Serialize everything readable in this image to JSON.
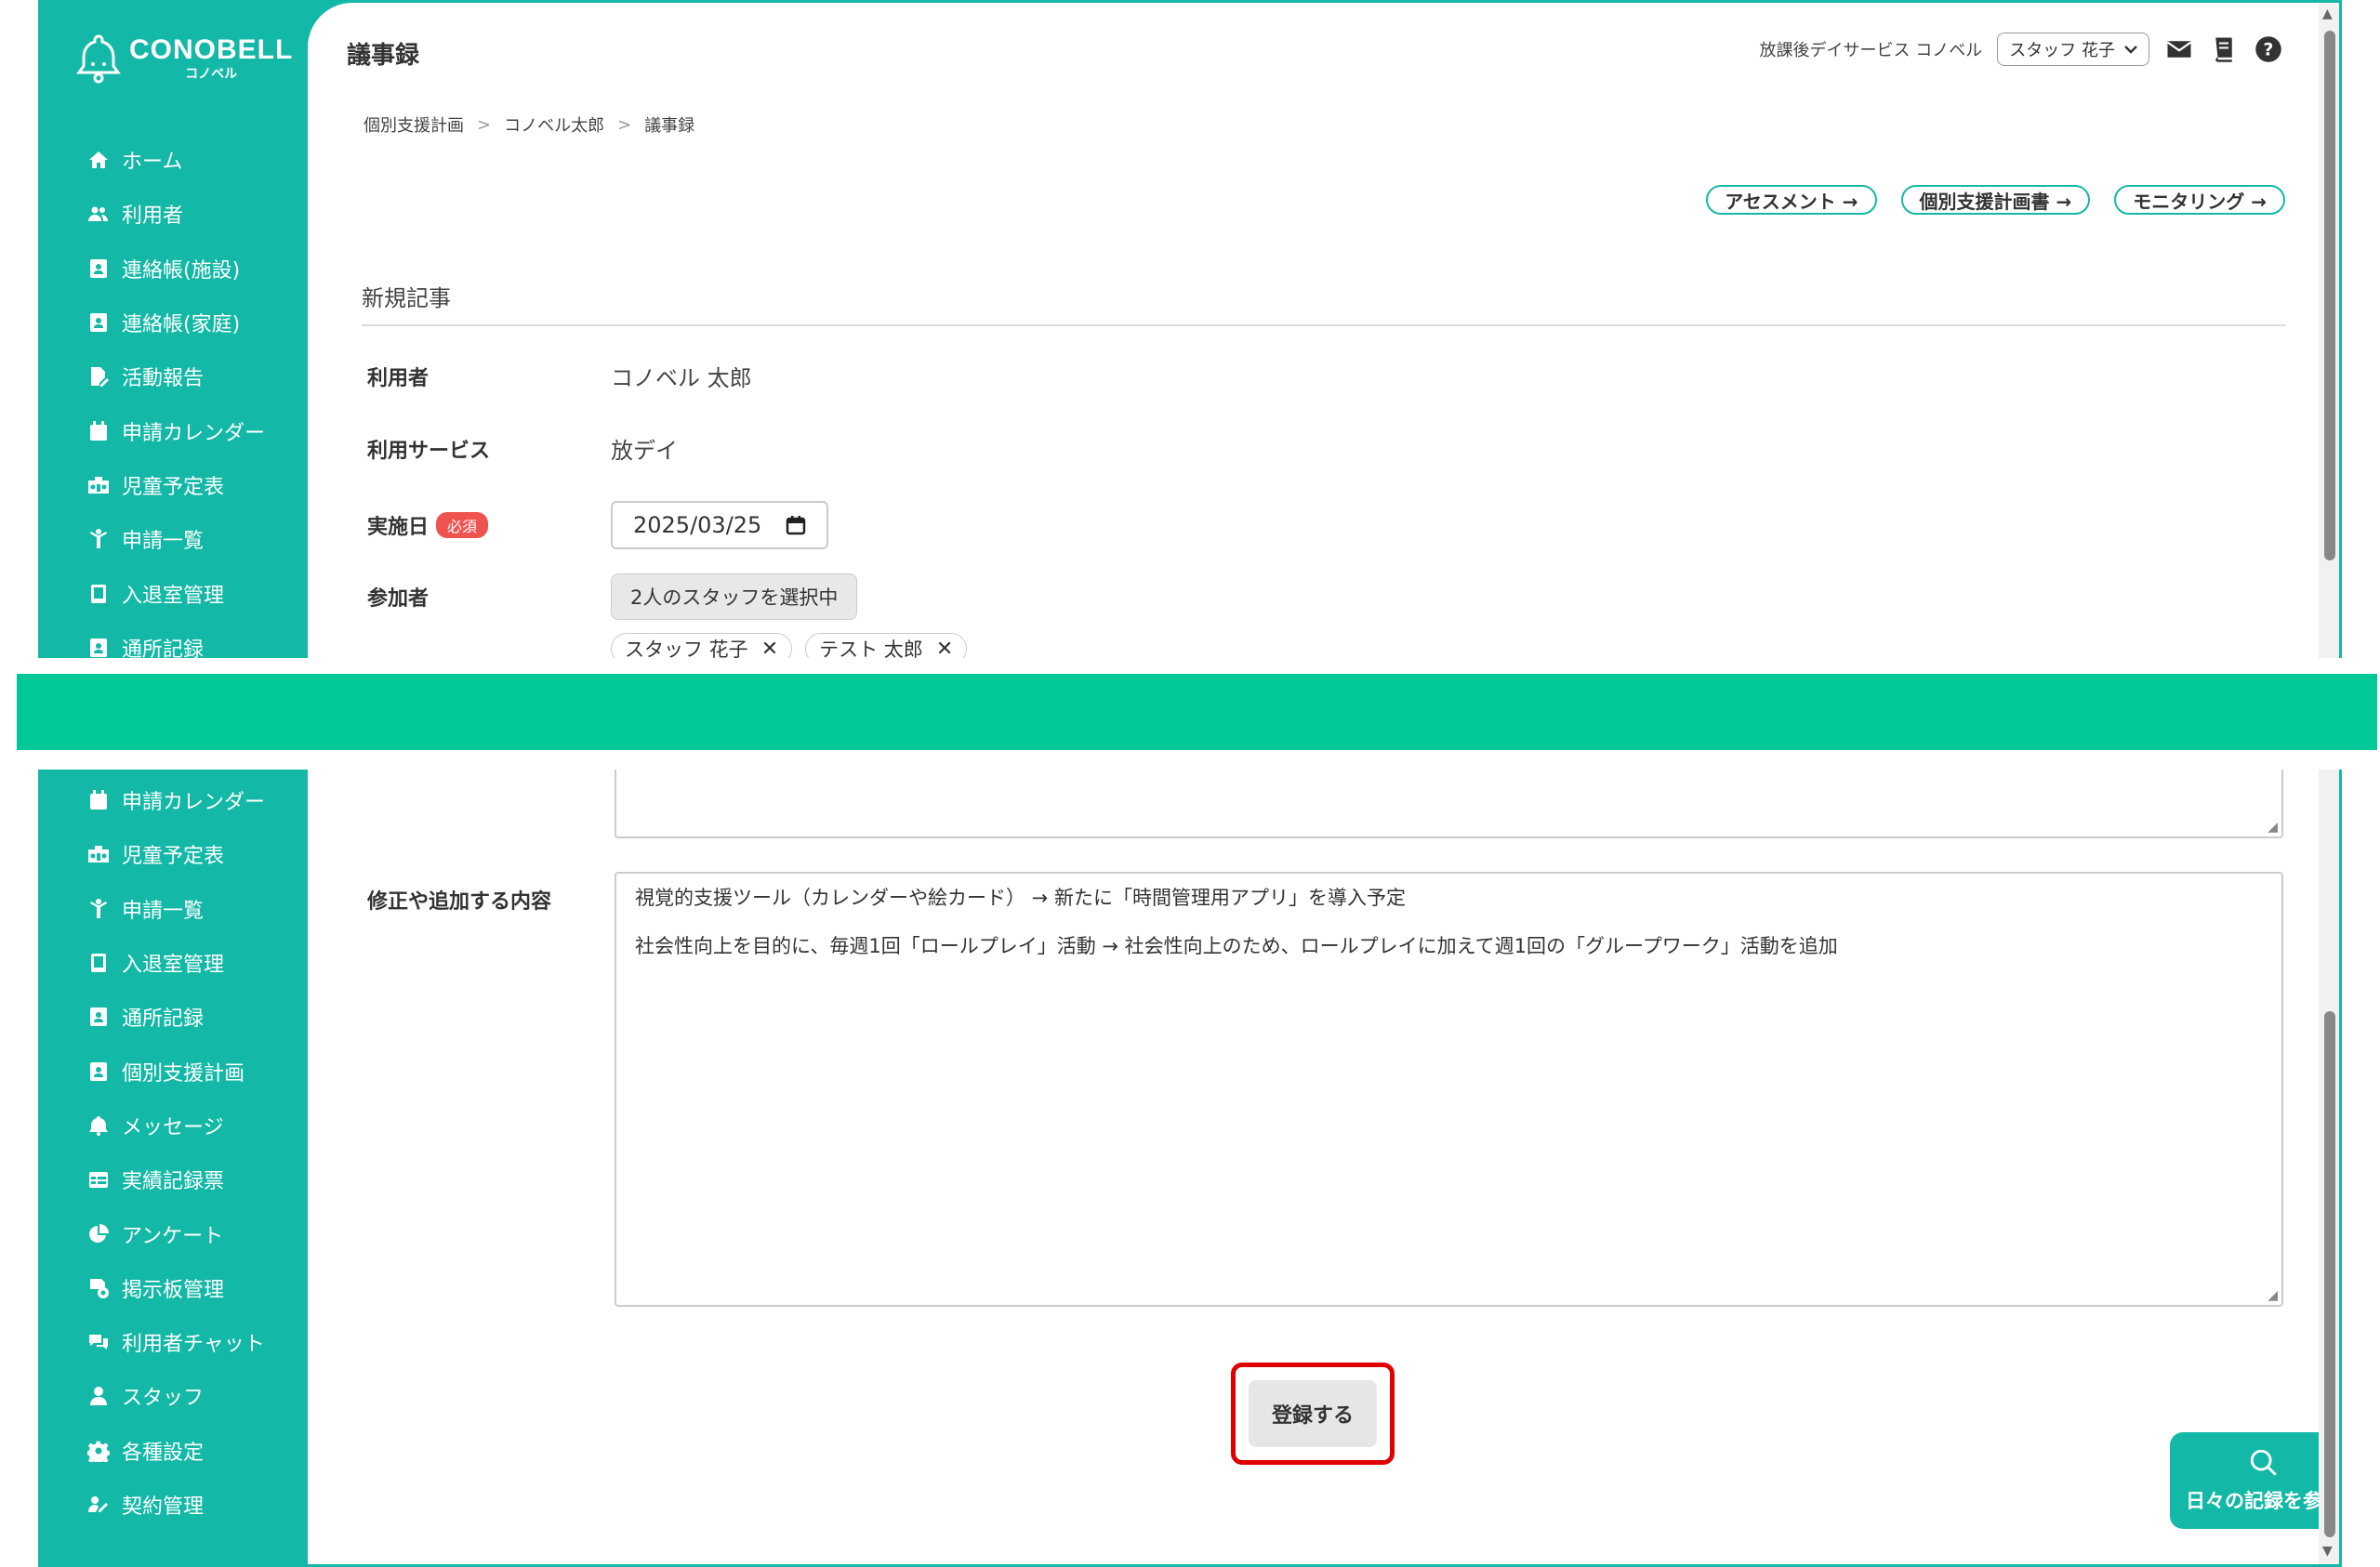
{
  "app": {
    "brand": "CONOBELL",
    "brand_sub": "コノベル",
    "page_title": "議事録",
    "facility": "放課後デイサービス コノベル",
    "staff_name": "スタッフ 花子"
  },
  "sidebar_top": [
    {
      "label": "ホーム",
      "icon": "home-icon"
    },
    {
      "label": "利用者",
      "icon": "users-icon"
    },
    {
      "label": "連絡帳(施設)",
      "icon": "contact-book-icon"
    },
    {
      "label": "連絡帳(家庭)",
      "icon": "contact-book-icon"
    },
    {
      "label": "活動報告",
      "icon": "report-edit-icon"
    },
    {
      "label": "申請カレンダー",
      "icon": "calendar-icon"
    },
    {
      "label": "児童予定表",
      "icon": "schedule-icon"
    },
    {
      "label": "申請一覧",
      "icon": "child-icon"
    },
    {
      "label": "入退室管理",
      "icon": "tablet-icon"
    },
    {
      "label": "通所記録",
      "icon": "contact-book-icon"
    }
  ],
  "sidebar_bottom": [
    {
      "label": "申請カレンダー",
      "icon": "calendar-icon"
    },
    {
      "label": "児童予定表",
      "icon": "schedule-icon"
    },
    {
      "label": "申請一覧",
      "icon": "child-icon"
    },
    {
      "label": "入退室管理",
      "icon": "tablet-icon"
    },
    {
      "label": "通所記録",
      "icon": "contact-book-icon"
    },
    {
      "label": "個別支援計画",
      "icon": "contact-book-icon"
    },
    {
      "label": "メッセージ",
      "icon": "bell-icon"
    },
    {
      "label": "実績記録票",
      "icon": "table-icon"
    },
    {
      "label": "アンケート",
      "icon": "pie-chart-icon"
    },
    {
      "label": "掲示板管理",
      "icon": "board-icon"
    },
    {
      "label": "利用者チャット",
      "icon": "chat-icon"
    },
    {
      "label": "スタッフ",
      "icon": "staff-icon"
    },
    {
      "label": "各種設定",
      "icon": "gear-icon"
    },
    {
      "label": "契約管理",
      "icon": "contract-icon"
    }
  ],
  "breadcrumb": [
    "個別支援計画",
    "コノベル太郎",
    "議事録"
  ],
  "pills": [
    "アセスメント →",
    "個別支援計画書 →",
    "モニタリング →"
  ],
  "form": {
    "section_title": "新規記事",
    "user_label": "利用者",
    "user_value": "コノベル 太郎",
    "service_label": "利用サービス",
    "service_value": "放デイ",
    "date_label": "実施日",
    "required_badge": "必須",
    "date_value": "2025/03/25",
    "participants_label": "参加者",
    "participants_button": "2人のスタッフを選択中",
    "participants": [
      "スタッフ 花子",
      "テスト 太郎"
    ],
    "changes_label": "修正や追加する内容",
    "changes_lines": [
      "視覚的支援ツール（カレンダーや絵カード） → 新たに「時間管理用アプリ」を導入予定",
      "社会性向上を目的に、毎週1回「ロールプレイ」活動 → 社会性向上のため、ロールプレイに加えて週1回の「グループワーク」活動を追加"
    ],
    "submit_label": "登録する"
  },
  "fab_label": "日々の記録を参照",
  "colors": {
    "teal": "#14b8a6",
    "band": "#00c896",
    "highlight": "#e00000"
  }
}
